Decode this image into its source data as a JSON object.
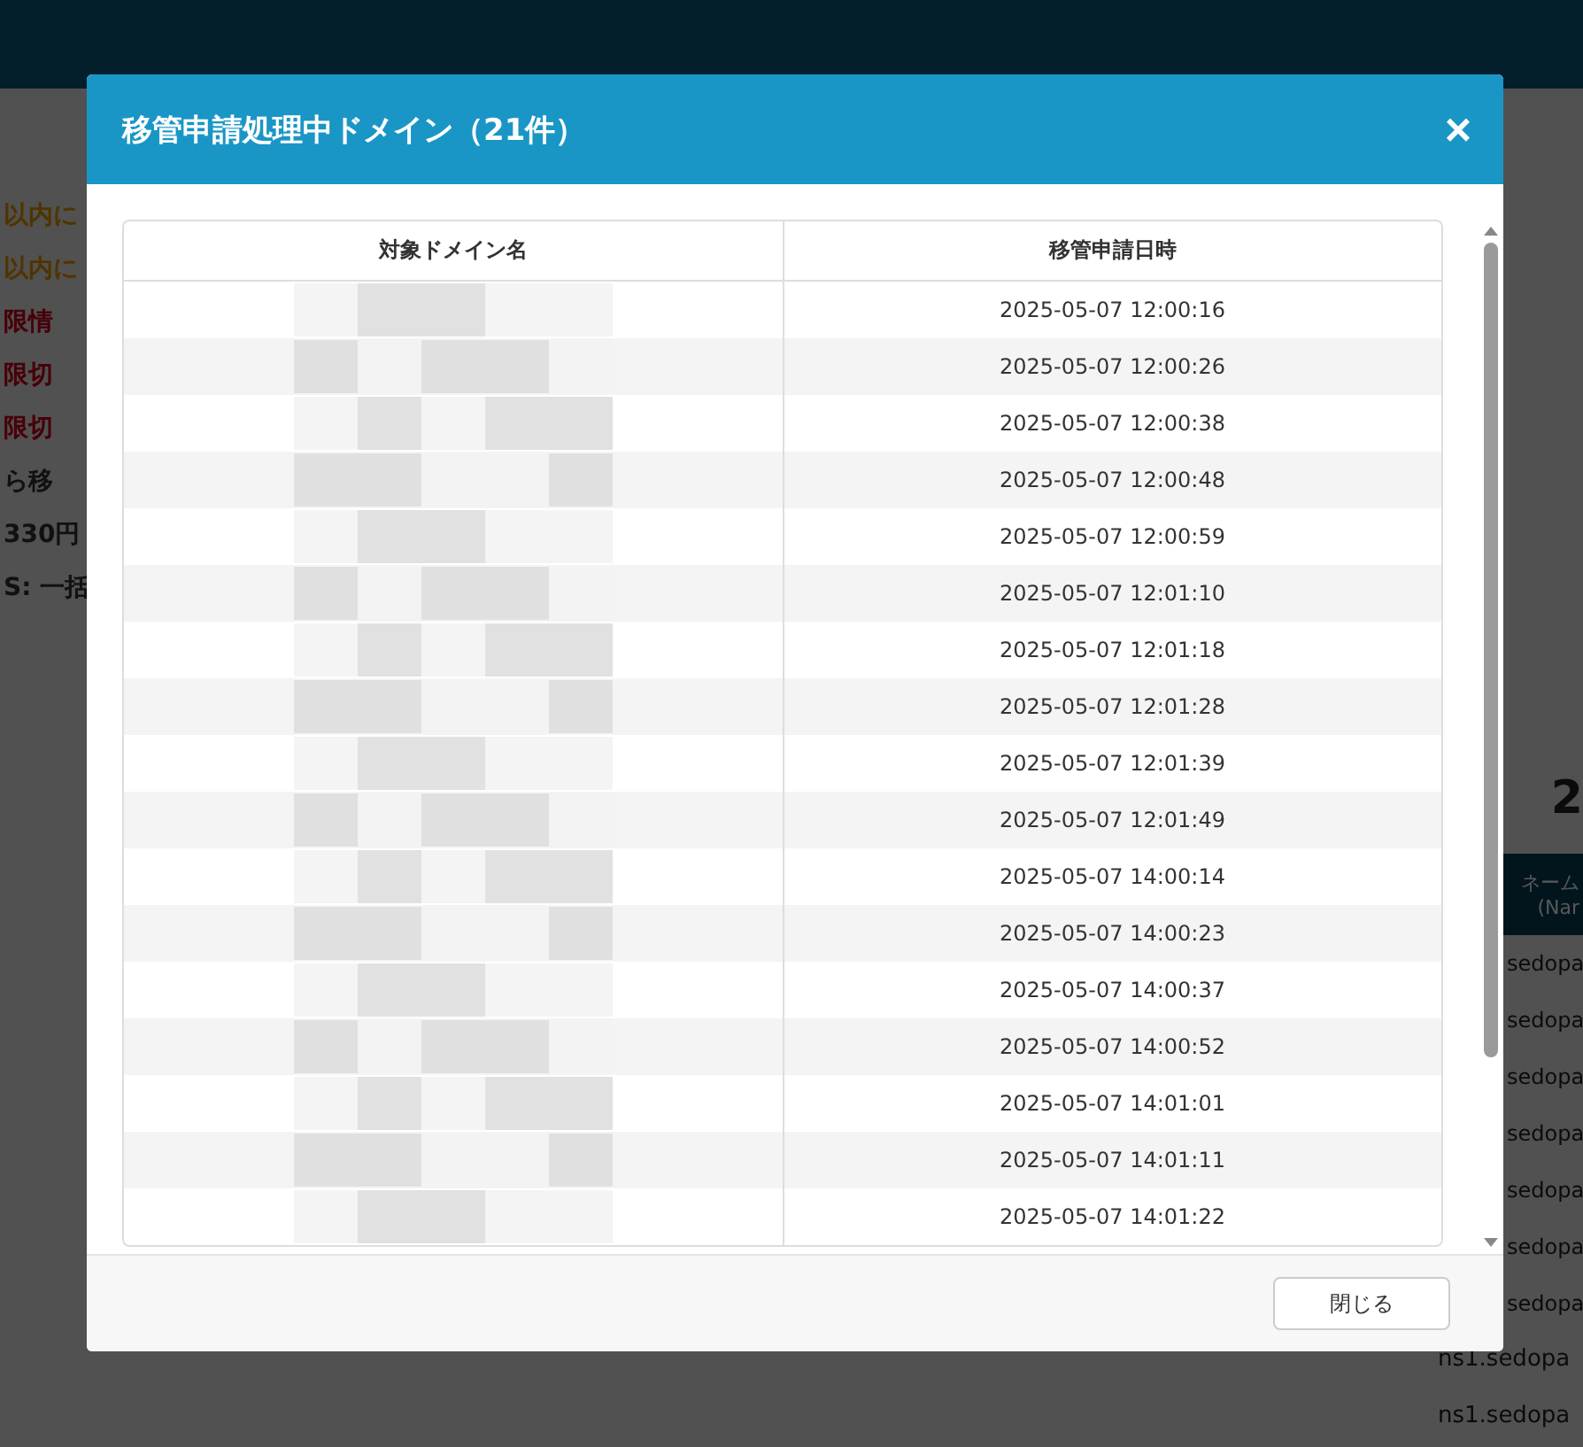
{
  "background": {
    "notices": [
      {
        "text": "以内に",
        "kind": "warning"
      },
      {
        "text": "以内に",
        "kind": "warning"
      },
      {
        "text": "限情",
        "kind": "alert"
      },
      {
        "text": "限切",
        "kind": "alert"
      },
      {
        "text": "限切",
        "kind": "alert"
      },
      {
        "text": "ら移",
        "kind": "plain"
      },
      {
        "text": "330円",
        "kind": "plain"
      },
      {
        "text": "S: 一括",
        "kind": "plain"
      }
    ],
    "side_heading": "2",
    "side_table": {
      "header": [
        "ネーム",
        "(Nar"
      ],
      "rows": [
        {
          "text": "sedopa",
          "kind": "partial"
        },
        {
          "text": "sedopa",
          "kind": "partial"
        },
        {
          "text": "sedopa",
          "kind": "partial"
        },
        {
          "text": "sedopa",
          "kind": "partial"
        },
        {
          "text": "sedopa",
          "kind": "partial"
        },
        {
          "text": "sedopa",
          "kind": "partial"
        },
        {
          "text": "sedopa",
          "kind": "partial"
        },
        {
          "text": "ns1.sedopa",
          "kind": "full"
        },
        {
          "text": "ns1.sedopa",
          "kind": "full"
        }
      ]
    }
  },
  "modal": {
    "title": "移管申請処理中ドメイン（21件）",
    "close": "×",
    "table": {
      "columns": [
        "対象ドメイン名",
        "移管申請日時"
      ],
      "rows": [
        {
          "requested_at": "2025-05-07 12:00:16"
        },
        {
          "requested_at": "2025-05-07 12:00:26"
        },
        {
          "requested_at": "2025-05-07 12:00:38"
        },
        {
          "requested_at": "2025-05-07 12:00:48"
        },
        {
          "requested_at": "2025-05-07 12:00:59"
        },
        {
          "requested_at": "2025-05-07 12:01:10"
        },
        {
          "requested_at": "2025-05-07 12:01:18"
        },
        {
          "requested_at": "2025-05-07 12:01:28"
        },
        {
          "requested_at": "2025-05-07 12:01:39"
        },
        {
          "requested_at": "2025-05-07 12:01:49"
        },
        {
          "requested_at": "2025-05-07 14:00:14"
        },
        {
          "requested_at": "2025-05-07 14:00:23"
        },
        {
          "requested_at": "2025-05-07 14:00:37"
        },
        {
          "requested_at": "2025-05-07 14:00:52"
        },
        {
          "requested_at": "2025-05-07 14:01:01"
        },
        {
          "requested_at": "2025-05-07 14:01:11"
        },
        {
          "requested_at": "2025-05-07 14:01:22"
        }
      ]
    },
    "buttons": [
      "閉じる"
    ]
  }
}
